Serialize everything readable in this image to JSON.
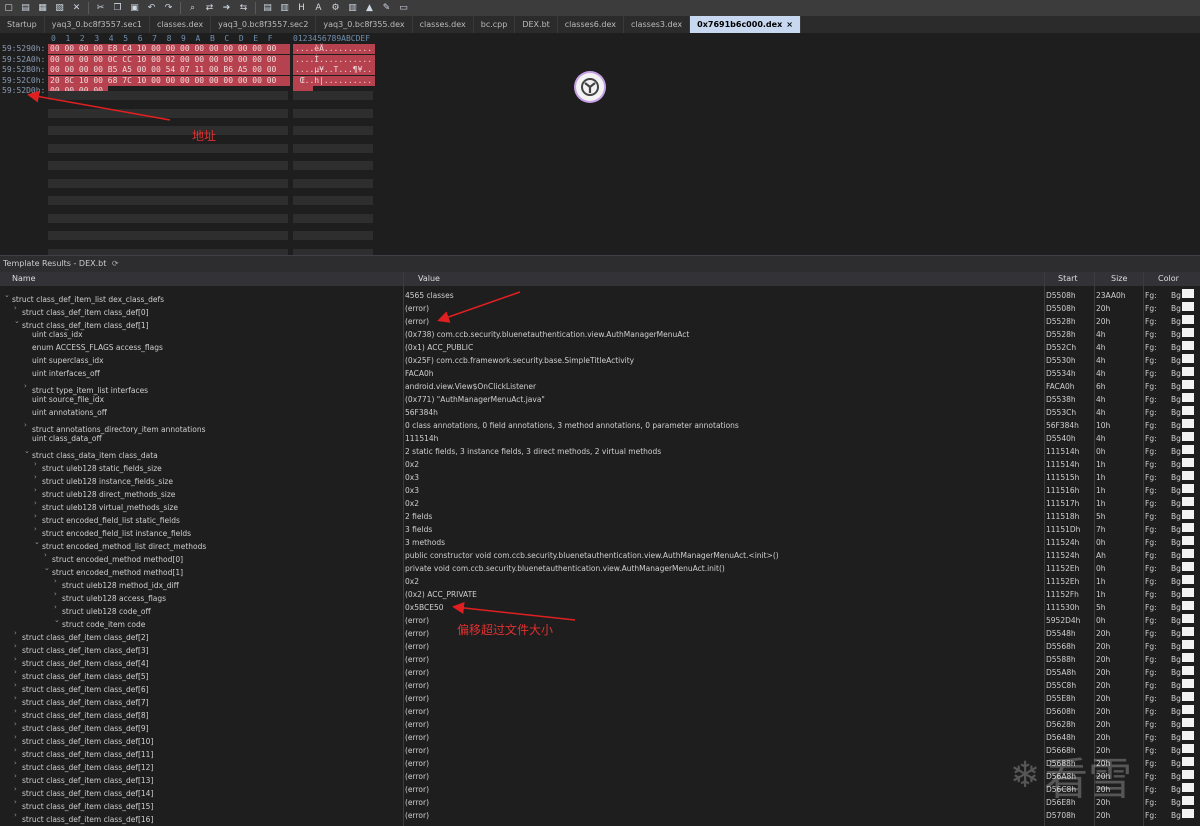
{
  "toolbar": {
    "icons": [
      "new-file-icon",
      "open-icon",
      "save-icon",
      "save-all-icon",
      "close-icon",
      "cut-icon",
      "copy-icon",
      "paste-icon",
      "undo-icon",
      "redo-icon",
      "find-icon",
      "replace-icon",
      "goto-icon",
      "compare-icon",
      "script-icon",
      "template-icon",
      "hex-icon",
      "ascii-icon",
      "settings-icon",
      "columns-icon",
      "chart-icon",
      "tools-icon",
      "pin-icon"
    ]
  },
  "tabs": [
    {
      "label": "Startup"
    },
    {
      "label": "yaq3_0.bc8f3557.sec1"
    },
    {
      "label": "classes.dex"
    },
    {
      "label": "yaq3_0.bc8f3557.sec2"
    },
    {
      "label": "yaq3_0.bc8f355.dex"
    },
    {
      "label": "classes.dex"
    },
    {
      "label": "bc.cpp"
    },
    {
      "label": "DEX.bt"
    },
    {
      "label": "classes6.dex"
    },
    {
      "label": "classes3.dex"
    },
    {
      "label": "0x7691b6c000.dex",
      "active": true,
      "close": "×"
    }
  ],
  "hex": {
    "column_header": "0  1  2  3  4  5  6  7  8  9  A  B  C  D  E  F",
    "ascii_header": "0123456789ABCDEF",
    "rows": [
      {
        "addr": "59:5290h:",
        "bytes": "00 00 00 00 E8 C4 10 00 00 00 00 00 00 00 00 00",
        "ascii": "....èÄ.........."
      },
      {
        "addr": "59:52A0h:",
        "bytes": "00 00 00 00 0C CC 10 00 02 00 00 00 00 00 00 00",
        "ascii": "....Ì..........."
      },
      {
        "addr": "59:52B0h:",
        "bytes": "00 00 00 00 B5 A5 00 00 54 07 11 00 B6 A5 00 00",
        "ascii": "....µ¥..T...¶¥.."
      },
      {
        "addr": "59:52C0h:",
        "bytes": "20 8C 10 00 68 7C 10 00 00 00 00 00 00 00 00 00",
        "ascii": " Œ..h|.........."
      },
      {
        "addr": "59:52D0h:",
        "bytes": "00 00 00 00",
        "ascii": "...."
      }
    ]
  },
  "annotations": {
    "address_label": "地址",
    "offset_label": "偏移超过文件大小"
  },
  "template": {
    "title": "Template Results - DEX.bt",
    "refresh_icon": "refresh-icon",
    "columns": {
      "name": "Name",
      "value": "Value",
      "start": "Start",
      "size": "Size",
      "color": "Color"
    },
    "fg_label": "Fg:",
    "bg_label": "Bg:",
    "rows": [
      {
        "indent": 0,
        "tog": "v",
        "name": "struct class_def_item_list dex_class_defs",
        "value": "4565 classes",
        "start": "D5508h",
        "size": "23AA0h"
      },
      {
        "indent": 1,
        "tog": ">",
        "name": "struct class_def_item class_def[0]",
        "value": "(error)",
        "start": "D5508h",
        "size": "20h"
      },
      {
        "indent": 1,
        "tog": "v",
        "name": "struct class_def_item class_def[1]",
        "value": "(error)",
        "start": "D5528h",
        "size": "20h"
      },
      {
        "indent": 2,
        "tog": "",
        "name": "uint class_idx",
        "value": "(0x738) com.ccb.security.bluenetauthentication.view.AuthManagerMenuAct",
        "start": "D5528h",
        "size": "4h"
      },
      {
        "indent": 2,
        "tog": "",
        "name": "enum ACCESS_FLAGS access_flags",
        "value": "(0x1) ACC_PUBLIC",
        "start": "D552Ch",
        "size": "4h"
      },
      {
        "indent": 2,
        "tog": "",
        "name": "uint superclass_idx",
        "value": "(0x25F) com.ccb.framework.security.base.SimpleTitleActivity",
        "start": "D5530h",
        "size": "4h"
      },
      {
        "indent": 2,
        "tog": "",
        "name": "uint interfaces_off",
        "value": "FACA0h",
        "start": "D5534h",
        "size": "4h"
      },
      {
        "indent": 2,
        "tog": ">",
        "name": "struct type_item_list interfaces",
        "value": "android.view.View$OnClickListener",
        "start": "FACA0h",
        "size": "6h"
      },
      {
        "indent": 2,
        "tog": "",
        "name": "uint source_file_idx",
        "value": "(0x771) \"AuthManagerMenuAct.java\"",
        "start": "D5538h",
        "size": "4h"
      },
      {
        "indent": 2,
        "tog": "",
        "name": "uint annotations_off",
        "value": "56F384h",
        "start": "D553Ch",
        "size": "4h"
      },
      {
        "indent": 2,
        "tog": ">",
        "name": "struct annotations_directory_item annotations",
        "value": "0 class annotations, 0 field annotations, 3 method annotations, 0 parameter annotations",
        "start": "56F384h",
        "size": "10h"
      },
      {
        "indent": 2,
        "tog": "",
        "name": "uint class_data_off",
        "value": "111514h",
        "start": "D5540h",
        "size": "4h"
      },
      {
        "indent": 2,
        "tog": "v",
        "name": "struct class_data_item class_data",
        "value": "2 static fields, 3 instance fields, 3 direct methods, 2 virtual methods",
        "start": "111514h",
        "size": "0h"
      },
      {
        "indent": 3,
        "tog": ">",
        "name": "struct uleb128 static_fields_size",
        "value": "0x2",
        "start": "111514h",
        "size": "1h"
      },
      {
        "indent": 3,
        "tog": ">",
        "name": "struct uleb128 instance_fields_size",
        "value": "0x3",
        "start": "111515h",
        "size": "1h"
      },
      {
        "indent": 3,
        "tog": ">",
        "name": "struct uleb128 direct_methods_size",
        "value": "0x3",
        "start": "111516h",
        "size": "1h"
      },
      {
        "indent": 3,
        "tog": ">",
        "name": "struct uleb128 virtual_methods_size",
        "value": "0x2",
        "start": "111517h",
        "size": "1h"
      },
      {
        "indent": 3,
        "tog": ">",
        "name": "struct encoded_field_list static_fields",
        "value": "2 fields",
        "start": "111518h",
        "size": "5h"
      },
      {
        "indent": 3,
        "tog": ">",
        "name": "struct encoded_field_list instance_fields",
        "value": "3 fields",
        "start": "11151Dh",
        "size": "7h"
      },
      {
        "indent": 3,
        "tog": "v",
        "name": "struct encoded_method_list direct_methods",
        "value": "3 methods",
        "start": "111524h",
        "size": "0h"
      },
      {
        "indent": 4,
        "tog": ">",
        "name": "struct encoded_method method[0]",
        "value": "public constructor void com.ccb.security.bluenetauthentication.view.AuthManagerMenuAct.<init>()",
        "start": "111524h",
        "size": "Ah"
      },
      {
        "indent": 4,
        "tog": "v",
        "name": "struct encoded_method method[1]",
        "value": "private void com.ccb.security.bluenetauthentication.view.AuthManagerMenuAct.init()",
        "start": "11152Eh",
        "size": "0h"
      },
      {
        "indent": 5,
        "tog": ">",
        "name": "struct uleb128 method_idx_diff",
        "value": "0x2",
        "start": "11152Eh",
        "size": "1h"
      },
      {
        "indent": 5,
        "tog": ">",
        "name": "struct uleb128 access_flags",
        "value": "(0x2) ACC_PRIVATE",
        "start": "11152Fh",
        "size": "1h"
      },
      {
        "indent": 5,
        "tog": ">",
        "name": "struct uleb128 code_off",
        "value": "0x5BCE50",
        "start": "111530h",
        "size": "5h"
      },
      {
        "indent": 5,
        "tog": "v",
        "name": "struct code_item code",
        "value": "(error)",
        "start": "5952D4h",
        "size": "0h"
      },
      {
        "indent": 1,
        "tog": ">",
        "name": "struct class_def_item class_def[2]",
        "value": "(error)",
        "start": "D5548h",
        "size": "20h"
      },
      {
        "indent": 1,
        "tog": ">",
        "name": "struct class_def_item class_def[3]",
        "value": "(error)",
        "start": "D5568h",
        "size": "20h"
      },
      {
        "indent": 1,
        "tog": ">",
        "name": "struct class_def_item class_def[4]",
        "value": "(error)",
        "start": "D5588h",
        "size": "20h"
      },
      {
        "indent": 1,
        "tog": ">",
        "name": "struct class_def_item class_def[5]",
        "value": "(error)",
        "start": "D55A8h",
        "size": "20h"
      },
      {
        "indent": 1,
        "tog": ">",
        "name": "struct class_def_item class_def[6]",
        "value": "(error)",
        "start": "D55C8h",
        "size": "20h"
      },
      {
        "indent": 1,
        "tog": ">",
        "name": "struct class_def_item class_def[7]",
        "value": "(error)",
        "start": "D55E8h",
        "size": "20h"
      },
      {
        "indent": 1,
        "tog": ">",
        "name": "struct class_def_item class_def[8]",
        "value": "(error)",
        "start": "D5608h",
        "size": "20h"
      },
      {
        "indent": 1,
        "tog": ">",
        "name": "struct class_def_item class_def[9]",
        "value": "(error)",
        "start": "D5628h",
        "size": "20h"
      },
      {
        "indent": 1,
        "tog": ">",
        "name": "struct class_def_item class_def[10]",
        "value": "(error)",
        "start": "D5648h",
        "size": "20h"
      },
      {
        "indent": 1,
        "tog": ">",
        "name": "struct class_def_item class_def[11]",
        "value": "(error)",
        "start": "D5668h",
        "size": "20h"
      },
      {
        "indent": 1,
        "tog": ">",
        "name": "struct class_def_item class_def[12]",
        "value": "(error)",
        "start": "D5688h",
        "size": "20h"
      },
      {
        "indent": 1,
        "tog": ">",
        "name": "struct class_def_item class_def[13]",
        "value": "(error)",
        "start": "D56A8h",
        "size": "20h"
      },
      {
        "indent": 1,
        "tog": ">",
        "name": "struct class_def_item class_def[14]",
        "value": "(error)",
        "start": "D56C8h",
        "size": "20h"
      },
      {
        "indent": 1,
        "tog": ">",
        "name": "struct class_def_item class_def[15]",
        "value": "(error)",
        "start": "D56E8h",
        "size": "20h"
      },
      {
        "indent": 1,
        "tog": ">",
        "name": "struct class_def_item class_def[16]",
        "value": "(error)",
        "start": "D5708h",
        "size": "20h"
      }
    ]
  },
  "watermark": {
    "text": "看雪"
  }
}
